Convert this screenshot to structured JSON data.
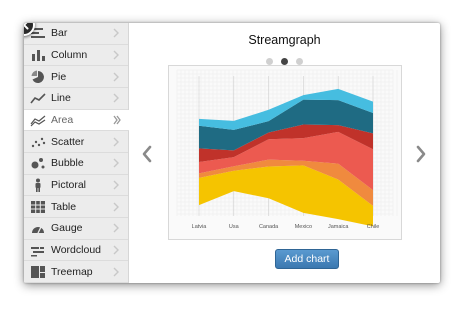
{
  "sidebar": {
    "items": [
      {
        "label": "Bar",
        "icon": "bar-chart-icon",
        "active": false
      },
      {
        "label": "Column",
        "icon": "column-chart-icon",
        "active": false
      },
      {
        "label": "Pie",
        "icon": "pie-chart-icon",
        "active": false
      },
      {
        "label": "Line",
        "icon": "line-chart-icon",
        "active": false
      },
      {
        "label": "Area",
        "icon": "area-chart-icon",
        "active": true
      },
      {
        "label": "Scatter",
        "icon": "scatter-chart-icon",
        "active": false
      },
      {
        "label": "Bubble",
        "icon": "bubble-chart-icon",
        "active": false
      },
      {
        "label": "Pictoral",
        "icon": "pictoral-chart-icon",
        "active": false
      },
      {
        "label": "Table",
        "icon": "table-icon",
        "active": false
      },
      {
        "label": "Gauge",
        "icon": "gauge-chart-icon",
        "active": false
      },
      {
        "label": "Wordcloud",
        "icon": "wordcloud-icon",
        "active": false
      },
      {
        "label": "Treemap",
        "icon": "treemap-icon",
        "active": false
      }
    ]
  },
  "preview": {
    "title": "Streamgraph",
    "page_count": 3,
    "current_page": 2,
    "add_button_label": "Add chart"
  },
  "chart_data": {
    "type": "area",
    "stacked": true,
    "categories": [
      "Latvia",
      "Usa",
      "Canada",
      "Mexico",
      "Jamaica",
      "Chile"
    ],
    "series": [
      {
        "color": "#f5c400",
        "values": [
          24,
          18,
          28,
          42,
          35,
          18
        ]
      },
      {
        "color": "#f08a3e",
        "values": [
          4,
          4,
          6,
          4,
          14,
          14
        ]
      },
      {
        "color": "#ec5a50",
        "values": [
          10,
          8,
          18,
          20,
          28,
          36
        ]
      },
      {
        "color": "#c0322a",
        "values": [
          12,
          6,
          6,
          12,
          6,
          14
        ]
      },
      {
        "color": "#1f6b83",
        "values": [
          20,
          18,
          10,
          22,
          22,
          18
        ]
      },
      {
        "color": "#46bde0",
        "values": [
          6,
          8,
          10,
          4,
          10,
          10
        ]
      }
    ],
    "ylim": [
      0,
      120
    ],
    "grid": true
  },
  "colors": {
    "button": "#4a89c2",
    "active_dot": "#444444",
    "inactive_dot": "#d0d0d0"
  }
}
